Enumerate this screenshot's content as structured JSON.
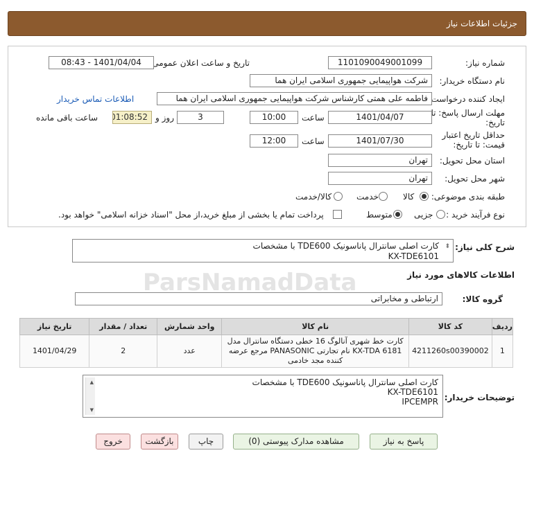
{
  "header": {
    "title": "جزئیات اطلاعات نیاز"
  },
  "form": {
    "need_number": {
      "label": "شماره نیاز:",
      "value": "1101090049001099"
    },
    "announce_datetime": {
      "label": "تاریخ و ساعت اعلان عمومی:",
      "value": "1401/04/04 - 08:43"
    },
    "buyer_org": {
      "label": "نام دستگاه خریدار:",
      "value": "شرکت هواپیمایی جمهوری اسلامی ایران هما"
    },
    "requester": {
      "label": "ایجاد کننده درخواست:",
      "value": "فاطمه علی همتی کارشناس شرکت هواپیمایی جمهوری اسلامی ایران هما",
      "contact_link": "اطلاعات تماس خریدار"
    },
    "reply_deadline": {
      "label_line1": "مهلت ارسال پاسخ: تا",
      "label_line2": "تاریخ:",
      "date": "1401/04/07",
      "time_label": "ساعت",
      "time": "10:00",
      "days": "3",
      "days_label": "روز و",
      "remaining": "01:08:52",
      "remaining_label": "ساعت باقی مانده"
    },
    "price_validity": {
      "label_line1": "حداقل تاریخ اعتبار",
      "label_line2": "قیمت: تا تاریخ:",
      "date": "1401/07/30",
      "time_label": "ساعت",
      "time": "12:00"
    },
    "delivery_province": {
      "label": "استان محل تحویل:",
      "value": "تهران"
    },
    "delivery_city": {
      "label": "شهر محل تحویل:",
      "value": "تهران"
    },
    "category": {
      "label": "طبقه بندی موضوعی:",
      "options": [
        "کالا",
        "خدمت",
        "کالا/خدمت"
      ],
      "selected": "کالا"
    },
    "purchase_type": {
      "label": "نوع فرآیند خرید :",
      "options": [
        "جزیی",
        "متوسط"
      ],
      "selected": "متوسط",
      "note": "پرداخت تمام یا بخشی از مبلغ خرید،از محل \"اسناد خزانه اسلامی\" خواهد بود."
    }
  },
  "general_description": {
    "label": "شرح کلی نیاز:",
    "line1": "کارت اصلی سانترال پاناسونیک TDE600 با مشخصات",
    "line2": "KX-TDE6101"
  },
  "goods_section": {
    "title": "اطلاعات کالاهای مورد نیاز"
  },
  "goods_group": {
    "label": "گروه کالا:",
    "value": "ارتباطی و مخابراتی"
  },
  "items_table": {
    "headers": [
      "ردیف",
      "کد کالا",
      "نام کالا",
      "واحد شمارش",
      "تعداد / مقدار",
      "تاریخ نیاز"
    ],
    "rows": [
      {
        "row": "1",
        "code": "4211260s00390002",
        "name": "کارت خط شهری آنالوگ 16 خطی دستگاه سانترال مدل KX-TDA 6181 نام تجارتی PANASONIC مرجع عرضه کننده مجد خادمی",
        "unit": "عدد",
        "qty": "2",
        "date": "1401/04/29"
      }
    ]
  },
  "buyer_notes": {
    "label": "توضیحات خریدار:",
    "line1": "کارت اصلی سانترال پاناسونیک TDE600 با مشخصات",
    "line2": "KX-TDE6101",
    "line3": "IPCEMPR"
  },
  "buttons": {
    "reply": "پاسخ به نیاز",
    "attachments": "مشاهده مدارک پیوستی (0)",
    "print": "چاپ",
    "back": "بازگشت",
    "exit": "خروج"
  },
  "colors": {
    "header_bg": "#8c5a2e",
    "link": "#1a5bb6",
    "remaining_bg": "#f6f0c8"
  }
}
